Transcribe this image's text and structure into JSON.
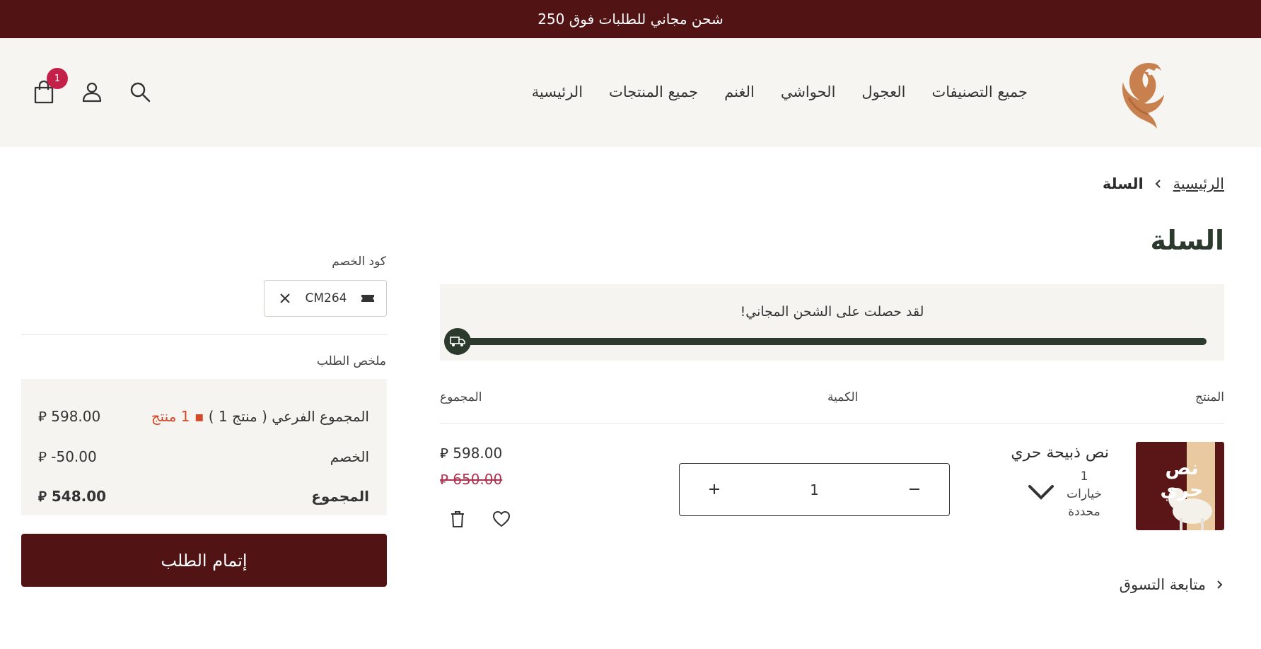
{
  "announcement": "شحن مجاني للطلبات فوق 250",
  "nav": [
    "الرئيسية",
    "جميع المنتجات",
    "الغنم",
    "الحواشي",
    "العجول",
    "جميع التصنيفات"
  ],
  "header": {
    "cart_count": "1"
  },
  "breadcrumb": {
    "home": "الرئيسية",
    "current": "السلة"
  },
  "page_title": "السلة",
  "shipping": {
    "message": "لقد حصلت على الشحن المجاني!",
    "progress": 1.0
  },
  "columns": {
    "product": "المنتج",
    "quantity": "الكمية",
    "total": "المجموع"
  },
  "cart_item": {
    "name": "نص ذبيحة حري",
    "image_text": "نص حري",
    "options_count": "1",
    "options_label": "خيارات محددة",
    "quantity": "1",
    "price": "598.00",
    "old_price": "650.00"
  },
  "continue_shopping": "متابعة التسوق",
  "coupon": {
    "label": "كود الخصم",
    "code": "CM264"
  },
  "summary": {
    "label": "ملخص الطلب",
    "subtotal_label": "المجموع الفرعي ( منتج 1 )",
    "subtotal_count": "1 منتج",
    "subtotal": "598.00",
    "discount_label": "الخصم",
    "discount": "-50.00",
    "total_label": "المجموع",
    "total": "548.00"
  },
  "checkout_label": "إتمام الطلب",
  "colors": {
    "brand": "#521315",
    "accent_green": "#2c3a2e",
    "badge": "#c4214a"
  }
}
